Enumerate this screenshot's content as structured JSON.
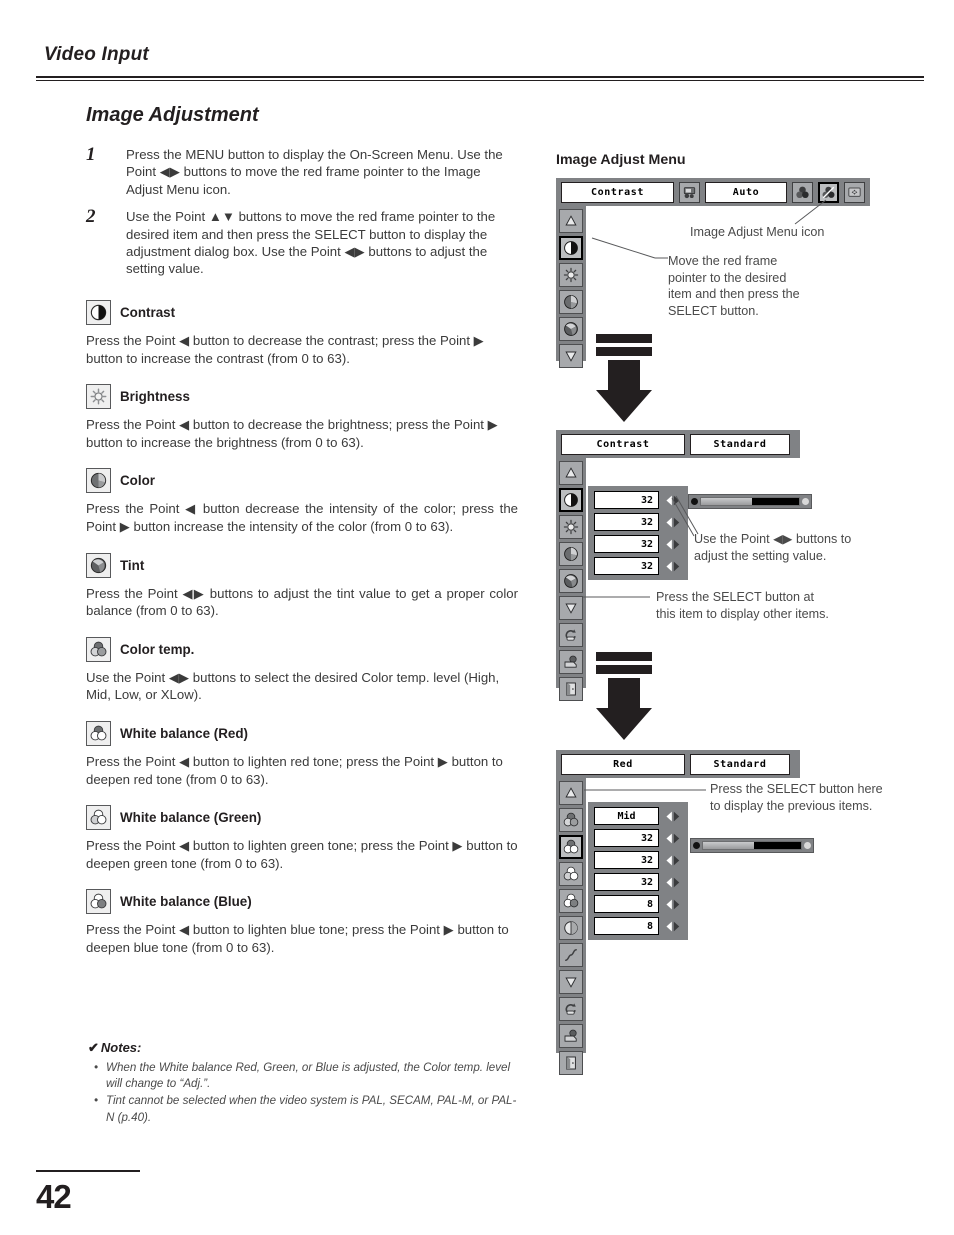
{
  "header": {
    "title": "Video Input"
  },
  "section": {
    "title": "Image Adjustment"
  },
  "steps": [
    {
      "num": "1",
      "text": "Press the MENU button to display the On-Screen Menu. Use the Point ◀▶ buttons to move the red frame pointer to the Image Adjust Menu icon."
    },
    {
      "num": "2",
      "text": "Use the Point ▲▼ buttons to move the red frame pointer to the desired item and then press the SELECT button to display the adjustment dialog box. Use the Point ◀▶ buttons to adjust the setting value."
    }
  ],
  "items": [
    {
      "icon": "contrast-icon",
      "label": "Contrast",
      "text": "Press the Point ◀ button to decrease the contrast; press the Point ▶ button to increase the contrast (from 0 to 63).",
      "justify": false
    },
    {
      "icon": "brightness-icon",
      "label": "Brightness",
      "text": "Press the Point ◀ button to decrease the brightness; press the Point ▶ button to increase the brightness (from 0 to 63).",
      "justify": false
    },
    {
      "icon": "color-icon",
      "label": "Color",
      "text": "Press the Point ◀ button decrease the intensity of the color; press the Point ▶ button increase the intensity of the color (from 0 to 63).",
      "justify": true
    },
    {
      "icon": "tint-icon",
      "label": "Tint",
      "text": "Press the Point ◀▶ buttons to adjust the tint value to get a proper color balance (from 0 to 63).",
      "justify": true
    },
    {
      "icon": "color-temp-icon",
      "label": "Color temp.",
      "text": "Use the Point ◀▶ buttons to select the desired Color temp. level (High, Mid, Low, or XLow).",
      "justify": false
    },
    {
      "icon": "white-balance-red-icon",
      "label": "White balance (Red)",
      "text": "Press the Point ◀ button to lighten red tone; press the Point ▶ button to deepen red tone (from 0 to 63).",
      "justify": false
    },
    {
      "icon": "white-balance-green-icon",
      "label": "White balance (Green)",
      "text": "Press the Point ◀ button to lighten green tone; press the Point ▶ button to deepen green tone (from 0 to 63).",
      "justify": false
    },
    {
      "icon": "white-balance-blue-icon",
      "label": "White balance (Blue)",
      "text": "Press the Point ◀ button to lighten blue tone; press the Point ▶ button to deepen blue tone (from 0 to 63).",
      "justify": false
    }
  ],
  "notes": {
    "heading": "Notes:",
    "check": "✔",
    "list": [
      "When the White balance Red, Green, or Blue is adjusted, the Color temp. level will change to “Adj.”.",
      "Tint cannot be selected when the video system is PAL, SECAM, PAL-M, or PAL-N (p.40)."
    ]
  },
  "page_number": "42",
  "right": {
    "title": "Image Adjust Menu",
    "menu1": {
      "field_label": "Contrast",
      "auto_label": "Auto",
      "icons": [
        "tv-icon",
        "color-balls-icon",
        "image-adjust-menu-icon",
        "screen-icon"
      ],
      "side_icons": [
        "up-arrow-icon",
        "contrast-icon",
        "brightness-icon",
        "color-icon",
        "tint-icon",
        "down-arrow-icon"
      ],
      "selected_side_index": 1,
      "selected_top_index": 2,
      "callout_icon": "Image Adjust Menu icon",
      "callout_move": "Move the red frame pointer to the desired item and then press the SELECT button."
    },
    "menu2": {
      "field_label": "Contrast",
      "preset_label": "Standard",
      "side_icons": [
        "up-arrow-icon",
        "contrast-icon",
        "brightness-icon",
        "color-icon",
        "tint-icon",
        "down-arrow-icon",
        "reset-icon",
        "store-icon",
        "quit-icon"
      ],
      "selected_side_index": 1,
      "values": [
        "32",
        "32",
        "32",
        "32"
      ],
      "gauge_percent": 52,
      "callout_adjust": "Use the Point ◀▶ buttons to adjust the setting value.",
      "callout_select": "Press the SELECT button at this item to display other items."
    },
    "menu3": {
      "field_label": "Red",
      "preset_label": "Standard",
      "side_icons": [
        "up-arrow-icon",
        "color-temp-icon",
        "white-balance-red-icon",
        "white-balance-green-icon",
        "white-balance-blue-icon",
        "sharpness-icon",
        "gamma-icon",
        "down-arrow-icon",
        "reset-icon",
        "store-icon",
        "quit-icon"
      ],
      "selected_side_index": 2,
      "values": [
        "Mid",
        "32",
        "32",
        "32",
        "8",
        "8"
      ],
      "gauge_percent": 52,
      "callout_prev": "Press the SELECT button here to display the previous items."
    }
  }
}
